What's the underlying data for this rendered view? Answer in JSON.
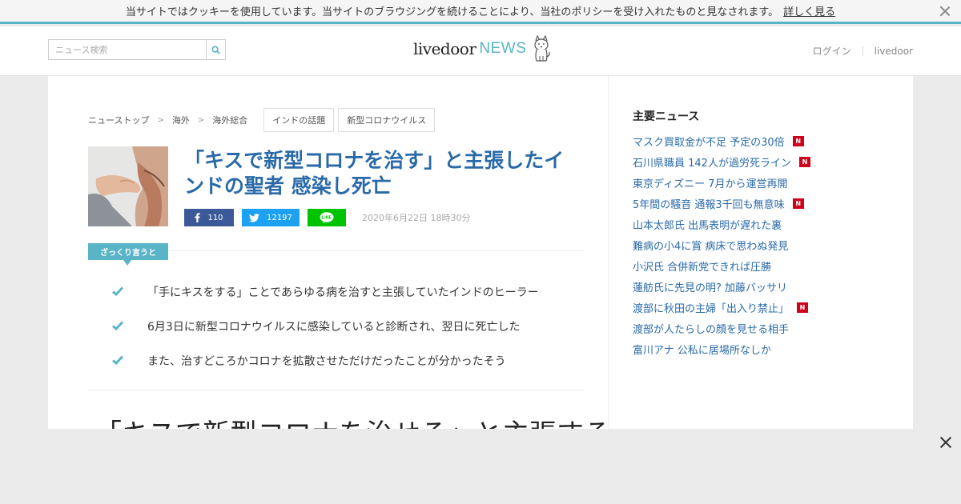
{
  "cookie_bar": {
    "message": "当サイトではクッキーを使用しています。当サイトのブラウジングを続けることにより、当社のポリシーを受け入れたものと見なされます。",
    "link_label": "詳しく見る"
  },
  "header": {
    "search_placeholder": "ニュース検索",
    "logo_text": "livedoor",
    "logo_news": "NEWS",
    "login_label": "ログイン",
    "livedoor_label": "livedoor"
  },
  "breadcrumb": {
    "items": [
      "ニューストップ",
      "海外",
      "海外総合"
    ],
    "separator": ">",
    "tags": [
      "インドの話題",
      "新型コロナウイルス"
    ]
  },
  "article": {
    "title": "「キスで新型コロナを治す」と主張したインドの聖者 感染し死亡",
    "share": {
      "facebook_count": "110",
      "twitter_count": "12197"
    },
    "date": "2020年6月22日 18時30分",
    "summary_label": "ざっくり言うと",
    "summary_points": [
      "「手にキスをする」ことであらゆる病を治すと主張していたインドのヒーラー",
      "6月3日に新型コロナウイルスに感染していると診断され、翌日に死亡した",
      "また、治すどころかコロナを拡散させただけだったことが分かったそう"
    ],
    "headline_partial": "「キスで新型コロナを治せる」と主張すると"
  },
  "sidebar": {
    "title": "主要ニュース",
    "items": [
      {
        "label": "マスク買取金が不足 予定の30倍",
        "new": true
      },
      {
        "label": "石川県職員 142人が過労死ライン",
        "new": true
      },
      {
        "label": "東京ディズニー 7月から運営再開",
        "new": false
      },
      {
        "label": "5年間の騒音 通報3千回も無意味",
        "new": true
      },
      {
        "label": "山本太郎氏 出馬表明が遅れた裏",
        "new": false
      },
      {
        "label": "難病の小4に賞 病床で思わぬ発見",
        "new": false
      },
      {
        "label": "小沢氏 合併新党できれば圧勝",
        "new": false
      },
      {
        "label": "蓮舫氏に先見の明? 加藤バッサリ",
        "new": false
      },
      {
        "label": "渡部に秋田の主婦「出入り禁止」",
        "new": true
      },
      {
        "label": "渡部が人たらしの顔を見せる相手",
        "new": false
      },
      {
        "label": "富川アナ 公私に居場所なしか",
        "new": false
      }
    ],
    "badge_text": "N"
  },
  "colors": {
    "accent": "#5ab4c8",
    "link": "#2a6aa8",
    "facebook": "#3b5998",
    "twitter": "#1da1f2",
    "line": "#00c300",
    "badge": "#d0021b"
  }
}
